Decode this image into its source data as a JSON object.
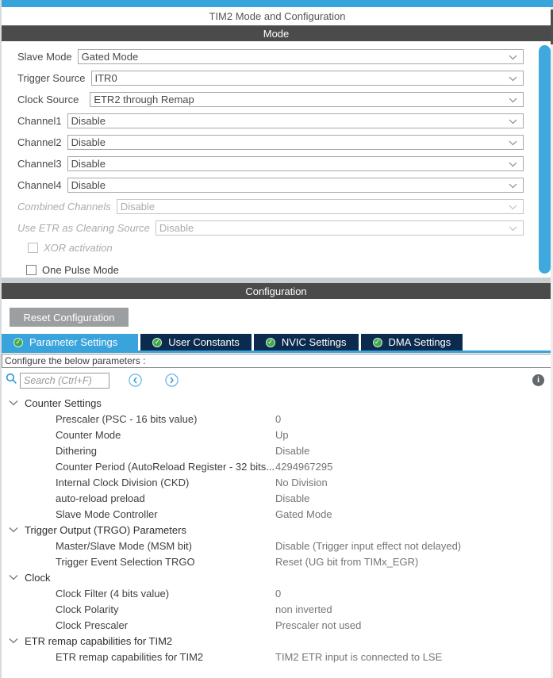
{
  "window": {
    "title": "TIM2 Mode and Configuration"
  },
  "colors": {
    "accent_blue": "#39a3dc",
    "tab_inactive_navy": "#0b2b4e",
    "badge_green": "#3fa84c",
    "section_header_gray": "#4b4b4b",
    "reset_button_gray": "#9c9fa1"
  },
  "icons": {
    "search": "magnifier",
    "prev": "chevron-left-circle",
    "next": "chevron-right-circle",
    "info": "info-circle",
    "tab_badge": "check-circle",
    "dropdown": "chevron-down",
    "tree_expand": "chevron-down"
  },
  "mode_section": {
    "header": "Mode",
    "dropdowns": [
      {
        "label": "Slave Mode",
        "value": "Gated Mode",
        "disabled": false
      },
      {
        "label": "Trigger Source",
        "value": "ITR0",
        "disabled": false
      },
      {
        "label": "Clock Source",
        "value": "ETR2 through Remap",
        "disabled": false
      },
      {
        "label": "Channel1",
        "value": "Disable",
        "disabled": false
      },
      {
        "label": "Channel2",
        "value": "Disable",
        "disabled": false
      },
      {
        "label": "Channel3",
        "value": "Disable",
        "disabled": false
      },
      {
        "label": "Channel4",
        "value": "Disable",
        "disabled": false
      },
      {
        "label": "Combined Channels",
        "value": "Disable",
        "disabled": true
      },
      {
        "label": "Use ETR as Clearing Source",
        "value": "Disable",
        "disabled": true
      }
    ],
    "checkboxes": [
      {
        "label": "XOR activation",
        "checked": false,
        "disabled": true
      },
      {
        "label": "One Pulse Mode",
        "checked": false,
        "disabled": false
      }
    ]
  },
  "config_section": {
    "header": "Configuration",
    "reset_button": "Reset Configuration",
    "tabs": [
      {
        "label": "Parameter Settings",
        "selected": true
      },
      {
        "label": "User Constants",
        "selected": false
      },
      {
        "label": "NVIC Settings",
        "selected": false
      },
      {
        "label": "DMA Settings",
        "selected": false
      }
    ],
    "configure_label": "Configure the below parameters :",
    "search": {
      "placeholder": "Search (Ctrl+F)"
    },
    "tree": [
      {
        "type": "group",
        "label": "Counter Settings"
      },
      {
        "type": "param",
        "label": "Prescaler (PSC - 16 bits value)",
        "value": "0"
      },
      {
        "type": "param",
        "label": "Counter Mode",
        "value": "Up"
      },
      {
        "type": "param",
        "label": "Dithering",
        "value": "Disable"
      },
      {
        "type": "param",
        "label": "Counter Period (AutoReload Register - 32 bits...",
        "value": "4294967295"
      },
      {
        "type": "param",
        "label": "Internal Clock Division (CKD)",
        "value": "No Division"
      },
      {
        "type": "param",
        "label": "auto-reload preload",
        "value": "Disable"
      },
      {
        "type": "param",
        "label": "Slave Mode Controller",
        "value": "Gated Mode"
      },
      {
        "type": "group",
        "label": "Trigger Output (TRGO) Parameters"
      },
      {
        "type": "param",
        "label": "Master/Slave Mode (MSM bit)",
        "value": "Disable (Trigger input effect not delayed)"
      },
      {
        "type": "param",
        "label": "Trigger Event Selection TRGO",
        "value": "Reset (UG bit from TIMx_EGR)"
      },
      {
        "type": "group",
        "label": "Clock"
      },
      {
        "type": "param",
        "label": "Clock Filter (4 bits value)",
        "value": "0"
      },
      {
        "type": "param",
        "label": "Clock Polarity",
        "value": "non inverted"
      },
      {
        "type": "param",
        "label": "Clock Prescaler",
        "value": "Prescaler not used"
      },
      {
        "type": "group",
        "label": "ETR remap capabilities for TIM2"
      },
      {
        "type": "param",
        "label": "ETR remap capabilities for TIM2",
        "value": "TIM2 ETR input is connected to LSE"
      }
    ]
  }
}
